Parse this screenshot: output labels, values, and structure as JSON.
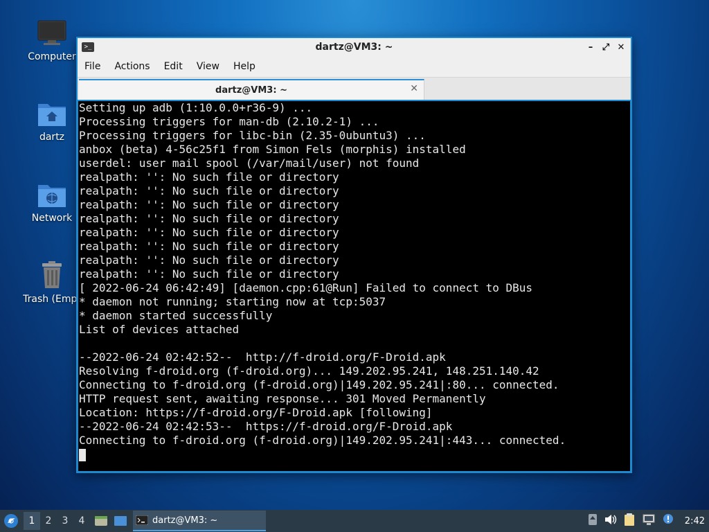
{
  "desktop": {
    "icons": [
      {
        "label": "Computer",
        "icon": "computer-icon"
      },
      {
        "label": "dartz",
        "icon": "home-folder-icon"
      },
      {
        "label": "Network",
        "icon": "network-folder-icon"
      },
      {
        "label": "Trash (Empt",
        "icon": "trash-icon"
      }
    ]
  },
  "window": {
    "title": "dartz@VM3: ~",
    "app_icon_text": ">_",
    "controls": {
      "minimize": "–",
      "maximize": "⤢",
      "close": "✕"
    },
    "menu": [
      "File",
      "Actions",
      "Edit",
      "View",
      "Help"
    ],
    "tab": {
      "label": "dartz@VM3: ~",
      "close": "✕"
    }
  },
  "terminal": {
    "lines": [
      "Setting up adb (1:10.0.0+r36-9) ...",
      "Processing triggers for man-db (2.10.2-1) ...",
      "Processing triggers for libc-bin (2.35-0ubuntu3) ...",
      "anbox (beta) 4-56c25f1 from Simon Fels (morphis) installed",
      "userdel: user mail spool (/var/mail/user) not found",
      "realpath: '': No such file or directory",
      "realpath: '': No such file or directory",
      "realpath: '': No such file or directory",
      "realpath: '': No such file or directory",
      "realpath: '': No such file or directory",
      "realpath: '': No such file or directory",
      "realpath: '': No such file or directory",
      "realpath: '': No such file or directory",
      "[ 2022-06-24 06:42:49] [daemon.cpp:61@Run] Failed to connect to DBus",
      "* daemon not running; starting now at tcp:5037",
      "* daemon started successfully",
      "List of devices attached",
      "",
      "--2022-06-24 02:42:52--  http://f-droid.org/F-Droid.apk",
      "Resolving f-droid.org (f-droid.org)... 149.202.95.241, 148.251.140.42",
      "Connecting to f-droid.org (f-droid.org)|149.202.95.241|:80... connected.",
      "HTTP request sent, awaiting response... 301 Moved Permanently",
      "Location: https://f-droid.org/F-Droid.apk [following]",
      "--2022-06-24 02:42:53--  https://f-droid.org/F-Droid.apk",
      "Connecting to f-droid.org (f-droid.org)|149.202.95.241|:443... connected."
    ]
  },
  "taskbar": {
    "workspaces": [
      "1",
      "2",
      "3",
      "4"
    ],
    "active_workspace": "1",
    "task_label": "dartz@VM3: ~",
    "clock": "2:42"
  },
  "colors": {
    "accent": "#2a8fd6",
    "terminal_bg": "#000000",
    "terminal_fg": "#e8e8e8",
    "taskbar_bg": "#2b3a47"
  }
}
